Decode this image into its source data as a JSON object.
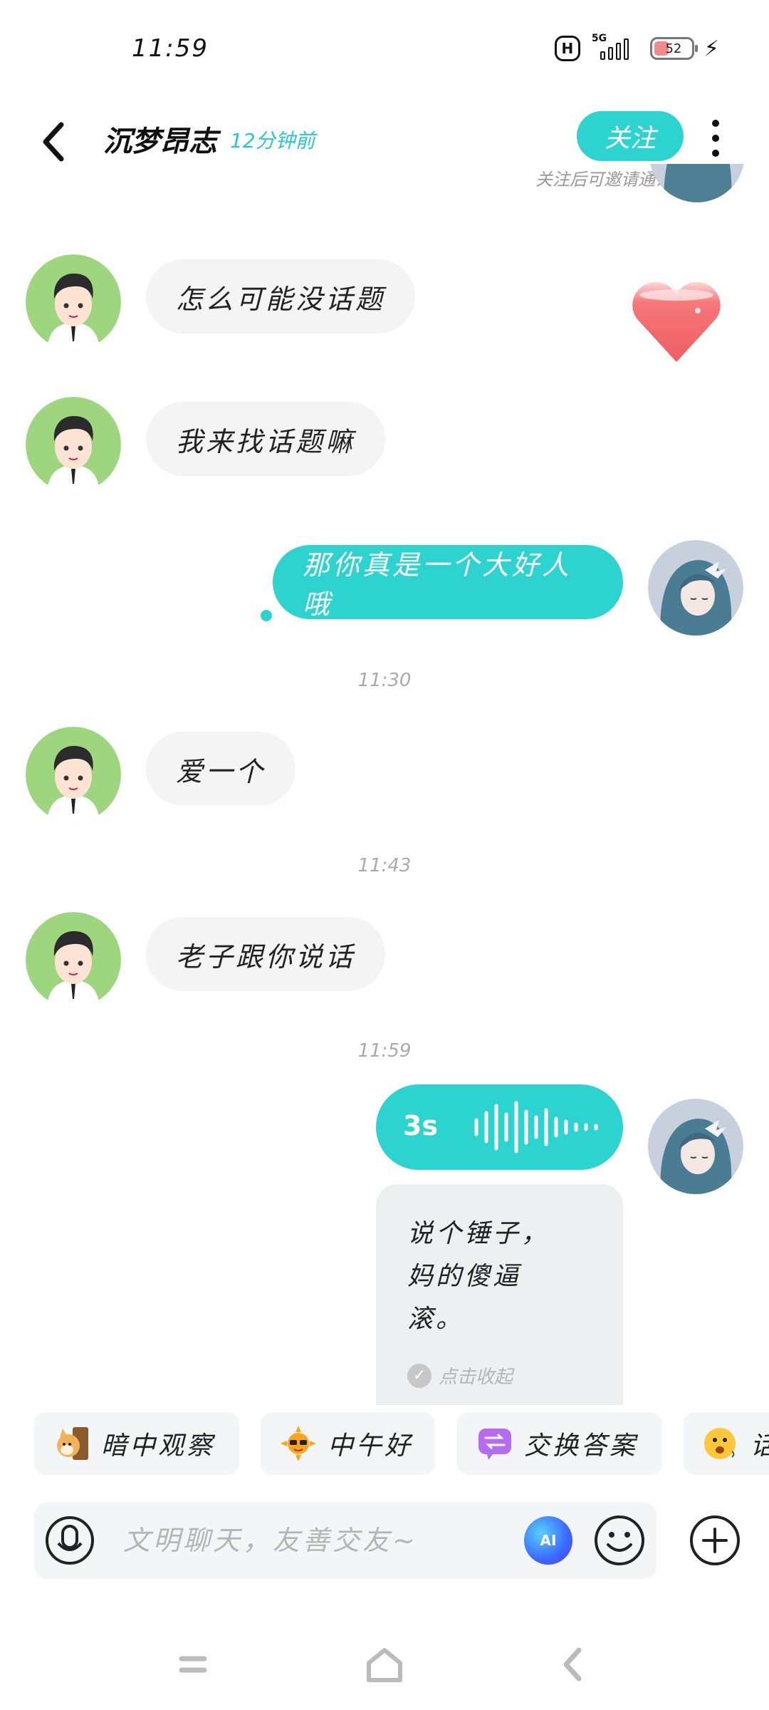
{
  "status_bar": {
    "time": "11:59",
    "hd": "H",
    "network": "5G",
    "battery": "52"
  },
  "header": {
    "name": "沉梦昂志",
    "last_seen": "12分钟前",
    "follow_label": "关注",
    "follow_hint": "关注后可邀请通话"
  },
  "messages": [
    {
      "side": "in",
      "text": "怎么可能没话题"
    },
    {
      "side": "in",
      "text": "我来找话题嘛"
    },
    {
      "side": "out",
      "text": "那你真是一个大好人哦"
    },
    {
      "time": "11:30"
    },
    {
      "side": "in",
      "text": "爱一个"
    },
    {
      "time": "11:43"
    },
    {
      "side": "in",
      "text": "老子跟你说话"
    },
    {
      "time": "11:59"
    }
  ],
  "voice_message": {
    "duration": "3s",
    "transcript": "说个锤子，\n妈的傻逼\n滚。",
    "collapse_label": "点击收起"
  },
  "quick_replies": [
    {
      "icon": "shiba-peek-icon",
      "label": "暗中观察"
    },
    {
      "icon": "sun-sunglasses-icon",
      "label": "中午好"
    },
    {
      "icon": "exchange-icon",
      "label": "交换答案"
    },
    {
      "icon": "smiley-speaking-icon",
      "label": "话"
    }
  ],
  "input": {
    "placeholder": "文明聊天，友善交友~",
    "ai_label": "AI"
  },
  "colors": {
    "accent": "#2dd4cf",
    "incoming_bubble": "#f4f4f4",
    "heart": "#f26a6e"
  }
}
